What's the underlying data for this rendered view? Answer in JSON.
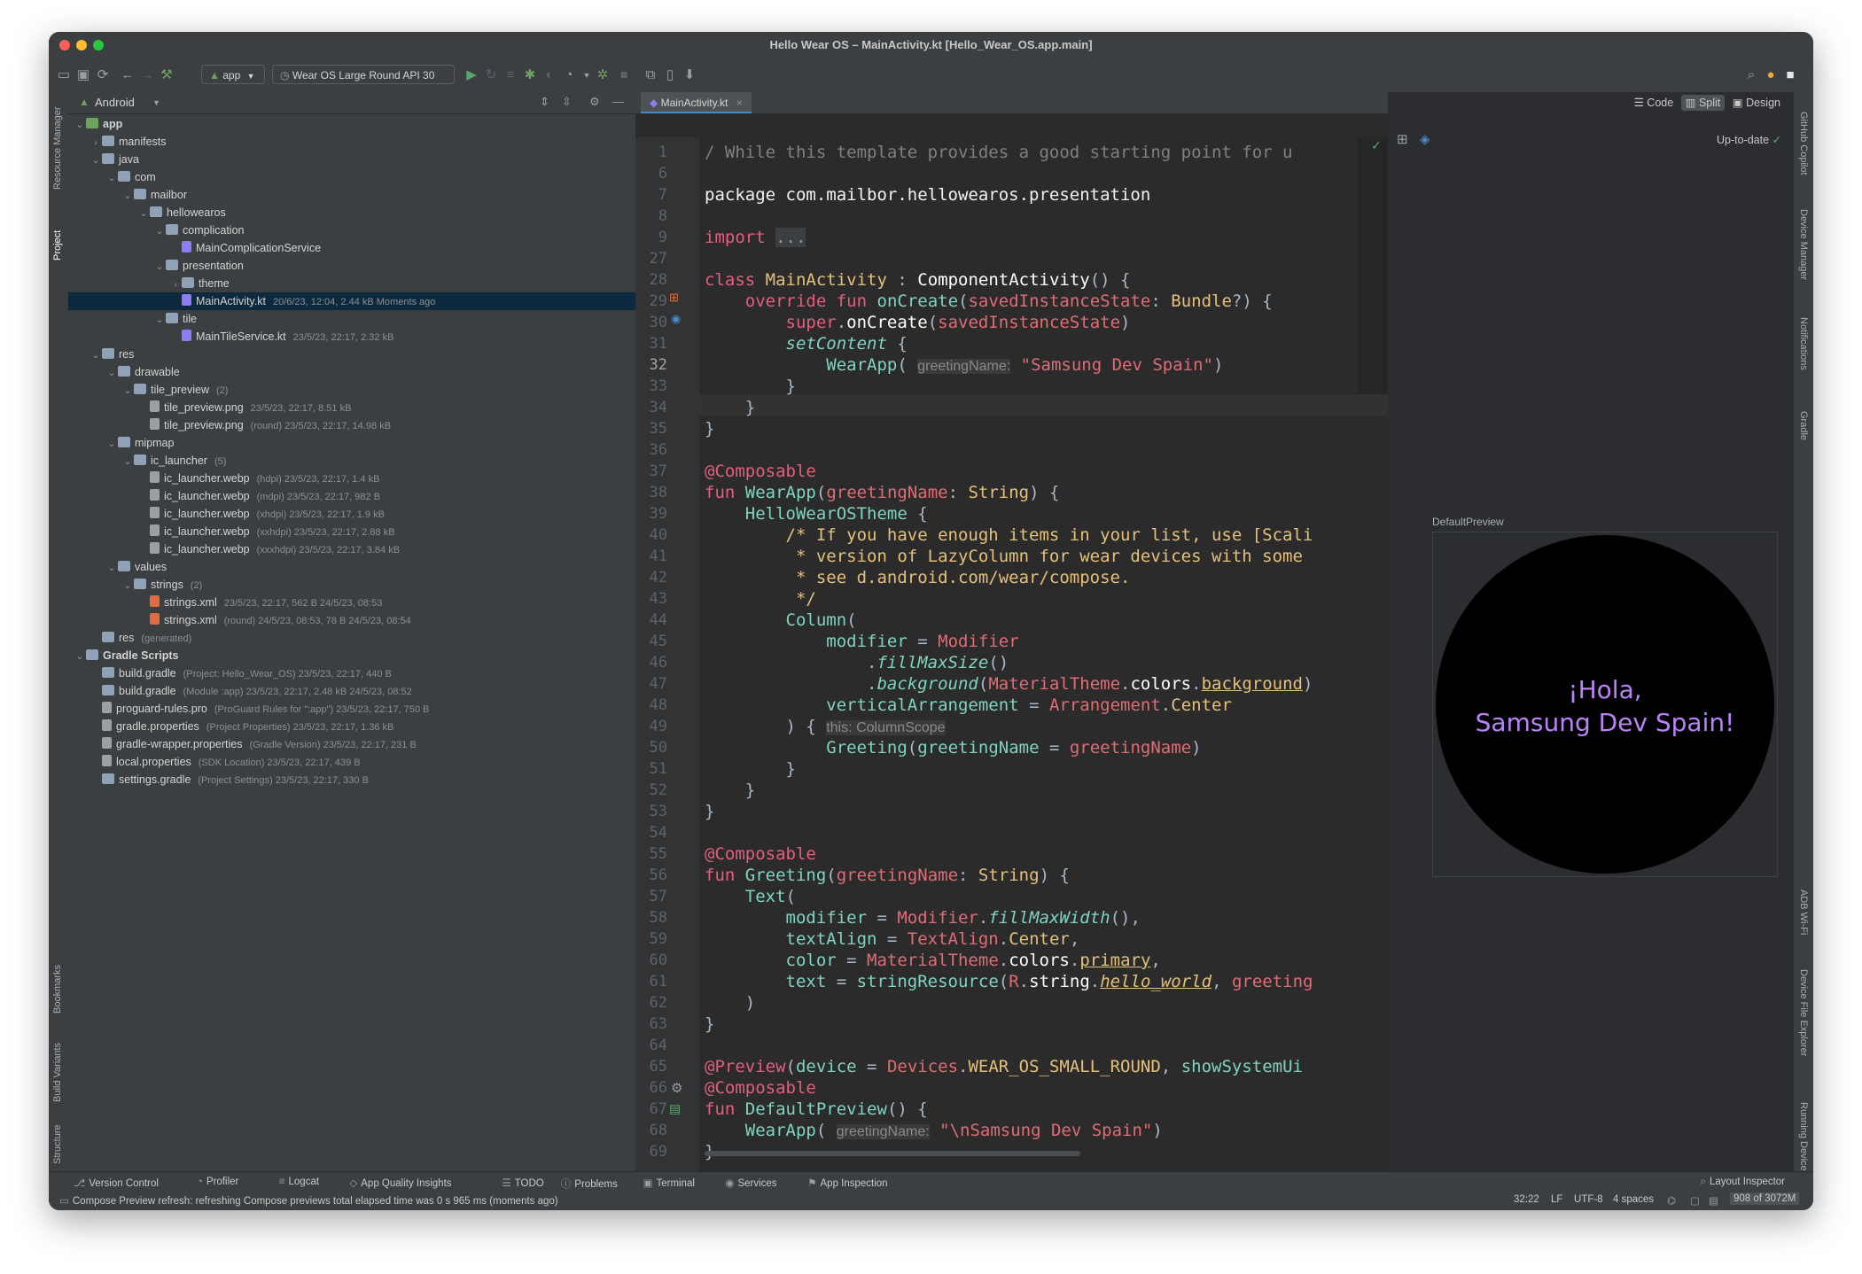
{
  "window": {
    "title": "Hello Wear OS – MainActivity.kt [Hello_Wear_OS.app.main]"
  },
  "toolbar": {
    "config_label": "app",
    "device_label": "Wear OS Large Round API 30"
  },
  "project_panel": {
    "view_label": "Android",
    "rows": [
      {
        "name": "app",
        "meta": "",
        "depth": 0,
        "chevron": "⌄",
        "kind": "module"
      },
      {
        "name": "manifests",
        "meta": "",
        "depth": 1,
        "chevron": "›",
        "kind": "folder"
      },
      {
        "name": "java",
        "meta": "",
        "depth": 1,
        "chevron": "⌄",
        "kind": "folder"
      },
      {
        "name": "com",
        "meta": "",
        "depth": 2,
        "chevron": "⌄",
        "kind": "folder"
      },
      {
        "name": "mailbor",
        "meta": "",
        "depth": 3,
        "chevron": "⌄",
        "kind": "folder"
      },
      {
        "name": "hellowearos",
        "meta": "",
        "depth": 4,
        "chevron": "⌄",
        "kind": "folder"
      },
      {
        "name": "complication",
        "meta": "",
        "depth": 5,
        "chevron": "⌄",
        "kind": "folder"
      },
      {
        "name": "MainComplicationService",
        "meta": "",
        "depth": 6,
        "chevron": "",
        "kind": "kotlin"
      },
      {
        "name": "presentation",
        "meta": "",
        "depth": 5,
        "chevron": "⌄",
        "kind": "folder"
      },
      {
        "name": "theme",
        "meta": "",
        "depth": 6,
        "chevron": "›",
        "kind": "folder"
      },
      {
        "name": "MainActivity.kt",
        "meta": "20/6/23, 12:04, 2.44 kB Moments ago",
        "depth": 6,
        "chevron": "",
        "kind": "kotlin",
        "selected": true
      },
      {
        "name": "tile",
        "meta": "",
        "depth": 5,
        "chevron": "⌄",
        "kind": "folder"
      },
      {
        "name": "MainTileService.kt",
        "meta": "23/5/23, 22:17, 2.32 kB",
        "depth": 6,
        "chevron": "",
        "kind": "kotlin"
      },
      {
        "name": "res",
        "meta": "",
        "depth": 1,
        "chevron": "⌄",
        "kind": "folder"
      },
      {
        "name": "drawable",
        "meta": "",
        "depth": 2,
        "chevron": "⌄",
        "kind": "folder"
      },
      {
        "name": "tile_preview",
        "meta": "(2)",
        "depth": 3,
        "chevron": "⌄",
        "kind": "folder"
      },
      {
        "name": "tile_preview.png",
        "meta": "23/5/23, 22:17, 8.51 kB",
        "depth": 4,
        "chevron": "",
        "kind": "image"
      },
      {
        "name": "tile_preview.png",
        "meta": "(round)   23/5/23, 22:17, 14.98 kB",
        "depth": 4,
        "chevron": "",
        "kind": "image"
      },
      {
        "name": "mipmap",
        "meta": "",
        "depth": 2,
        "chevron": "⌄",
        "kind": "folder"
      },
      {
        "name": "ic_launcher",
        "meta": "(5)",
        "depth": 3,
        "chevron": "⌄",
        "kind": "folder"
      },
      {
        "name": "ic_launcher.webp",
        "meta": "(hdpi)   23/5/23, 22:17, 1.4 kB",
        "depth": 4,
        "chevron": "",
        "kind": "image"
      },
      {
        "name": "ic_launcher.webp",
        "meta": "(mdpi)   23/5/23, 22:17, 982 B",
        "depth": 4,
        "chevron": "",
        "kind": "image"
      },
      {
        "name": "ic_launcher.webp",
        "meta": "(xhdpi)   23/5/23, 22:17, 1.9 kB",
        "depth": 4,
        "chevron": "",
        "kind": "image"
      },
      {
        "name": "ic_launcher.webp",
        "meta": "(xxhdpi)   23/5/23, 22:17, 2.88 kB",
        "depth": 4,
        "chevron": "",
        "kind": "image"
      },
      {
        "name": "ic_launcher.webp",
        "meta": "(xxxhdpi)   23/5/23, 22:17, 3.84 kB",
        "depth": 4,
        "chevron": "",
        "kind": "image"
      },
      {
        "name": "values",
        "meta": "",
        "depth": 2,
        "chevron": "⌄",
        "kind": "folder"
      },
      {
        "name": "strings",
        "meta": "(2)",
        "depth": 3,
        "chevron": "⌄",
        "kind": "folder"
      },
      {
        "name": "strings.xml",
        "meta": "23/5/23, 22:17, 562 B 24/5/23, 08:53",
        "depth": 4,
        "chevron": "",
        "kind": "xml"
      },
      {
        "name": "strings.xml",
        "meta": "(round)   24/5/23, 08:53, 78 B 24/5/23, 08:54",
        "depth": 4,
        "chevron": "",
        "kind": "xml"
      },
      {
        "name": "res",
        "meta": "(generated)",
        "depth": 1,
        "chevron": "",
        "kind": "folder"
      },
      {
        "name": "Gradle Scripts",
        "meta": "",
        "depth": 0,
        "chevron": "⌄",
        "kind": "gradle"
      },
      {
        "name": "build.gradle",
        "meta": "(Project: Hello_Wear_OS)   23/5/23, 22:17, 440 B",
        "depth": 1,
        "chevron": "",
        "kind": "gradle"
      },
      {
        "name": "build.gradle",
        "meta": "(Module :app)   23/5/23, 22:17, 2.48 kB 24/5/23, 08:52",
        "depth": 1,
        "chevron": "",
        "kind": "gradle"
      },
      {
        "name": "proguard-rules.pro",
        "meta": "(ProGuard Rules for \":app\")   23/5/23, 22:17, 750 B",
        "depth": 1,
        "chevron": "",
        "kind": "file"
      },
      {
        "name": "gradle.properties",
        "meta": "(Project Properties)   23/5/23, 22:17, 1.36 kB",
        "depth": 1,
        "chevron": "",
        "kind": "props"
      },
      {
        "name": "gradle-wrapper.properties",
        "meta": "(Gradle Version)   23/5/23, 22:17, 231 B",
        "depth": 1,
        "chevron": "",
        "kind": "props"
      },
      {
        "name": "local.properties",
        "meta": "(SDK Location)   23/5/23, 22:17, 439 B",
        "depth": 1,
        "chevron": "",
        "kind": "props"
      },
      {
        "name": "settings.gradle",
        "meta": "(Project Settings)   23/5/23, 22:17, 330 B",
        "depth": 1,
        "chevron": "",
        "kind": "gradle"
      }
    ]
  },
  "left_strip": {
    "top_labels": [
      "Resource Manager",
      "Project"
    ],
    "bottom_labels": [
      "Bookmarks",
      "Build Variants",
      "Structure"
    ]
  },
  "right_strip": {
    "top_labels": [
      "GitHub Copilot",
      "Device Manager",
      "Notifications",
      "Gradle"
    ],
    "bottom_labels": [
      "ADB Wi-Fi",
      "Device File Explorer",
      "Running Devices"
    ]
  },
  "editor": {
    "tab_label": "MainActivity.kt",
    "current_line": "32",
    "lines": [
      {
        "n": "1",
        "html": "<span style=\"color:#808080\">/ While this template provides a good starting point for u</span>"
      },
      {
        "n": "6",
        "html": ""
      },
      {
        "n": "7",
        "html": "<span style=\"color:#f2f2f2\">package com.mailbor.hellowearos.presentation</span>"
      },
      {
        "n": "8",
        "html": ""
      },
      {
        "n": "9",
        "html": "<span style=\"color:#e45f7d\">import</span> <span style=\"background:#3b3f42;color:#9a9a9a\">...</span>"
      },
      {
        "n": "27",
        "html": ""
      },
      {
        "n": "28",
        "html": "<span style=\"color:#e45f7d\">class</span> <span style=\"color:#e5c07b\">MainActivity</span> : <span style=\"color:#ffffff\">ComponentActivity</span>() {"
      },
      {
        "n": "29",
        "html": "    <span style=\"color:#e45f7d\">override fun</span> <span style=\"color:#7fd4c1\">onCreate</span>(<span style=\"color:#e06c75\">savedInstanceState</span>: <span style=\"color:#e5c07b\">Bundle</span>?) {"
      },
      {
        "n": "30",
        "html": "        <span style=\"color:#e45f7d\">super</span>.<span style=\"color:#ffffff\">onCreate</span>(<span style=\"color:#e06c75\">savedInstanceState</span>)"
      },
      {
        "n": "31",
        "html": "        <span style=\"color:#7fd4c1;font-style:italic\">setContent</span> {"
      },
      {
        "n": "32",
        "html": "            <span style=\"color:#7fd4c1\">WearApp</span>( <span style=\"color:#8a8a8a;font-family:'Liberation Sans',sans-serif;font-size:16px;background:#3a3a3a\">greetingName:</span> <span style=\"color:#e06c75\">\"Samsung Dev Spain\"</span>)"
      },
      {
        "n": "33",
        "html": "        }"
      },
      {
        "n": "34",
        "html": "    }"
      },
      {
        "n": "35",
        "html": "}"
      },
      {
        "n": "36",
        "html": ""
      },
      {
        "n": "37",
        "html": "<span style=\"color:#e45f7d\">@Composable</span>"
      },
      {
        "n": "38",
        "html": "<span style=\"color:#e45f7d\">fun</span> <span style=\"color:#7fd4c1\">WearApp</span>(<span style=\"color:#e06c75\">greetingName</span>: <span style=\"color:#e5c07b\">String</span>) {"
      },
      {
        "n": "39",
        "html": "    <span style=\"color:#7fd4c1\">HelloWearOSTheme</span> {"
      },
      {
        "n": "40",
        "html": "        <span style=\"color:#e5c07b\">/* If you have enough items in your list, use [Scali</span>"
      },
      {
        "n": "41",
        "html": "<span style=\"color:#e5c07b\">         * version of LazyColumn for wear devices with some</span>"
      },
      {
        "n": "42",
        "html": "<span style=\"color:#e5c07b\">         * see d.android.com/wear/compose.</span>"
      },
      {
        "n": "43",
        "html": "<span style=\"color:#e5c07b\">         */</span>"
      },
      {
        "n": "44",
        "html": "        <span style=\"color:#7fd4c1\">Column</span>("
      },
      {
        "n": "45",
        "html": "            <span style=\"color:#7fd4c1\">modifier</span> = <span style=\"color:#e06c75\">Modifier</span>"
      },
      {
        "n": "46",
        "html": "                .<span style=\"color:#7fd4c1;font-style:italic\">fillMaxSize</span>()"
      },
      {
        "n": "47",
        "html": "                .<span style=\"color:#7fd4c1;font-style:italic\">background</span>(<span style=\"color:#e06c75\">MaterialTheme</span>.<span style=\"color:#ffffff\">colors</span>.<span style=\"color:#e5c07b;text-decoration:underline\">background</span>)"
      },
      {
        "n": "48",
        "html": "            <span style=\"color:#7fd4c1\">verticalArrangement</span> = <span style=\"color:#e06c75\">Arrangement</span>.<span style=\"color:#e5c07b\">Center</span>"
      },
      {
        "n": "49",
        "html": "        ) { <span style=\"color:#8a8a8a;font-family:'Liberation Sans',sans-serif;font-size:16px;background:#3a3a3a\">this: ColumnScope</span>"
      },
      {
        "n": "50",
        "html": "            <span style=\"color:#7fd4c1\">Greeting</span>(<span style=\"color:#7fd4c1\">greetingName</span> = <span style=\"color:#e06c75\">greetingName</span>)"
      },
      {
        "n": "51",
        "html": "        }"
      },
      {
        "n": "52",
        "html": "    }"
      },
      {
        "n": "53",
        "html": "}"
      },
      {
        "n": "54",
        "html": ""
      },
      {
        "n": "55",
        "html": "<span style=\"color:#e45f7d\">@Composable</span>"
      },
      {
        "n": "56",
        "html": "<span style=\"color:#e45f7d\">fun</span> <span style=\"color:#7fd4c1\">Greeting</span>(<span style=\"color:#e06c75\">greetingName</span>: <span style=\"color:#e5c07b\">String</span>) {"
      },
      {
        "n": "57",
        "html": "    <span style=\"color:#7fd4c1\">Text</span>("
      },
      {
        "n": "58",
        "html": "        <span style=\"color:#7fd4c1\">modifier</span> = <span style=\"color:#e06c75\">Modifier</span>.<span style=\"color:#7fd4c1;font-style:italic\">fillMaxWidth</span>(),"
      },
      {
        "n": "59",
        "html": "        <span style=\"color:#7fd4c1\">textAlign</span> = <span style=\"color:#e06c75\">TextAlign</span>.<span style=\"color:#e5c07b\">Center</span>,"
      },
      {
        "n": "60",
        "html": "        <span style=\"color:#7fd4c1\">color</span> = <span style=\"color:#e06c75\">MaterialTheme</span>.<span style=\"color:#ffffff\">colors</span>.<span style=\"color:#e5c07b;text-decoration:underline\">primary</span>,"
      },
      {
        "n": "61",
        "html": "        <span style=\"color:#7fd4c1\">text</span> = <span style=\"color:#7fd4c1\">stringResource</span>(<span style=\"color:#e06c75\">R</span>.<span style=\"color:#ffffff\">string</span>.<span style=\"color:#e5c07b;font-style:italic;text-decoration:underline\">hello_world</span>, <span style=\"color:#e06c75\">greeting</span>"
      },
      {
        "n": "62",
        "html": "    )"
      },
      {
        "n": "63",
        "html": "}"
      },
      {
        "n": "64",
        "html": ""
      },
      {
        "n": "65",
        "html": "<span style=\"color:#e45f7d\">@Preview</span>(<span style=\"color:#7fd4c1\">device</span> = <span style=\"color:#e06c75\">Devices</span>.<span style=\"color:#e5c07b\">WEAR_OS_SMALL_ROUND</span>, <span style=\"color:#7fd4c1\">showSystemUi</span>"
      },
      {
        "n": "66",
        "html": "<span style=\"color:#e45f7d\">@Composable</span>"
      },
      {
        "n": "67",
        "html": "<span style=\"color:#e45f7d\">fun</span> <span style=\"color:#7fd4c1\">DefaultPreview</span>() {"
      },
      {
        "n": "68",
        "html": "    <span style=\"color:#7fd4c1\">WearApp</span>( <span style=\"color:#8a8a8a;font-family:'Liberation Sans',sans-serif;font-size:16px;background:#3a3a3a\">greetingName:</span> <span style=\"color:#e06c75\">\"\\nSamsung Dev Spain\"</span>)"
      },
      {
        "n": "69",
        "html": "}"
      }
    ]
  },
  "preview": {
    "modes": [
      "Code",
      "Split",
      "Design"
    ],
    "status": "Up-to-date",
    "preview_name": "DefaultPreview",
    "watch_line1": "¡Hola,",
    "watch_line2": "Samsung Dev Spain!",
    "text_color": "#b983f7"
  },
  "bottom_tools": [
    {
      "label": "Version Control",
      "icon": "⎇"
    },
    {
      "label": "Profiler",
      "icon": "◔"
    },
    {
      "label": "Logcat",
      "icon": "≡"
    },
    {
      "label": "App Quality Insights",
      "icon": "◇"
    },
    {
      "label": "TODO",
      "icon": "☰"
    },
    {
      "label": "Problems",
      "icon": "ⓘ"
    },
    {
      "label": "Terminal",
      "icon": "▣"
    },
    {
      "label": "Services",
      "icon": "◉"
    },
    {
      "label": "App Inspection",
      "icon": "⚑"
    }
  ],
  "status": {
    "layout_inspector": "Layout Inspector",
    "message": "Compose Preview refresh: refreshing Compose previews total elapsed time was 0 s 965 ms (moments ago)",
    "position": "32:22",
    "line_ending": "LF",
    "encoding": "UTF-8",
    "indent": "4 spaces",
    "memory": "908 of 3072M"
  }
}
